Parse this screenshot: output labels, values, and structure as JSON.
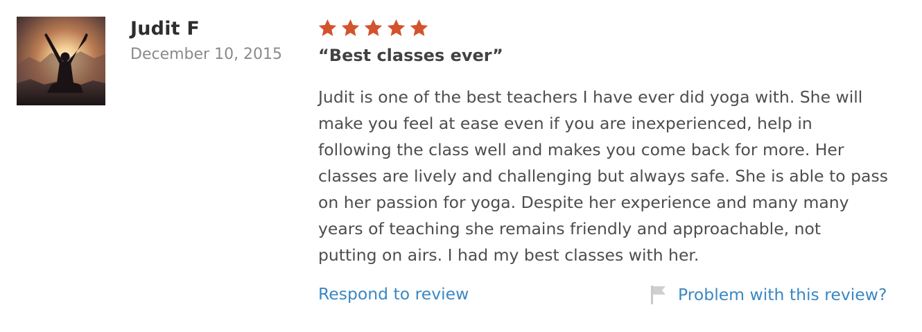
{
  "reviewer": {
    "name": "Judit F",
    "date": "December 10, 2015",
    "avatar_icon": "silhouette-sunset-photo"
  },
  "rating": {
    "stars": 5,
    "max_stars": 5,
    "star_color": "#d2532c"
  },
  "review": {
    "title": "“Best classes ever”",
    "body_lines": [
      "Judit is one of the best teachers I have ever did yoga with. She will",
      "make you feel at ease even if you are inexperienced, help in",
      "following the class well and makes you come back for more. Her",
      "classes are lively and challenging but always safe. She is able to pass",
      "on her passion for yoga. Despite her experience and many many",
      "years of teaching she remains friendly and approachable, not",
      "putting on airs. I had my best classes with her."
    ]
  },
  "actions": {
    "respond_label": "Respond to review",
    "problem_label": "Problem with this review?",
    "flag_icon": "flag-icon",
    "link_color": "#3b87c2"
  }
}
